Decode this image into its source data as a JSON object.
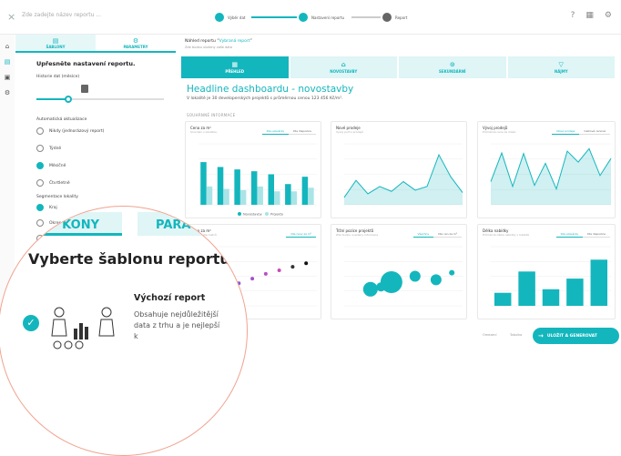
{
  "topbar": {
    "close_icon": "×",
    "title_placeholder": "Zde zadejte název reportu ...",
    "steps": [
      "Výběr dat",
      "Nastavení reportu",
      "Report"
    ],
    "icons": [
      "help-icon",
      "grid-icon",
      "settings-icon"
    ]
  },
  "rail": [
    "home-icon",
    "report-icon",
    "folder-icon",
    "settings-icon"
  ],
  "sidebar": {
    "tabs": [
      {
        "label": "ŠABLONY",
        "icon": "▤"
      },
      {
        "label": "PARAMETRY",
        "icon": "⚙"
      }
    ],
    "title": "Upřesněte nastavení reportu.",
    "history_label": "Historie dat (měsíce)",
    "history_value": 0.25,
    "auto_update_label": "Automatická aktualizace",
    "auto_update_options": [
      "Nikdy (jednorázový report)",
      "Týdně",
      "Měsíčně",
      "Čtvrtletně"
    ],
    "auto_update_selected": 2,
    "segmentation_label": "Segmentace lokality",
    "segmentation_options": [
      "Kraj",
      "Okres",
      ""
    ],
    "segmentation_selected": 0
  },
  "main": {
    "crumb_prefix": "Náhled reportu",
    "crumb_name": "Vybraná report",
    "crumb_sub": "Zde budou uloženy vaše data",
    "categories": [
      {
        "label": "PŘEHLED",
        "icon": "▦"
      },
      {
        "label": "NOVOSTAVBY",
        "icon": "⌂"
      },
      {
        "label": "SEKUNDÁRNÍ",
        "icon": "⊙"
      },
      {
        "label": "NÁJMY",
        "icon": "▽"
      }
    ],
    "active_category": 0,
    "headline": "Headline dashboardu - novostavby",
    "subline": "V lokalitě je 30 developerských projektů s průměrnou cenou 123 456 Kč/m².",
    "section": "SOUHRNNÉ INFORMACE"
  },
  "cards": [
    {
      "title": "Cena za m²",
      "sub": "Srovnání s lokalitou",
      "buttons": [
        "Dle uzávěrky",
        "Dle dispozice"
      ],
      "active": 0
    },
    {
      "title": "Nové prodeje",
      "sub": "Vývoj počtu prodejů",
      "buttons": [],
      "active": -1
    },
    {
      "title": "Vývoj prodejů",
      "sub": "Průměrná cena za měsíc",
      "buttons": [
        "Nové prodeje",
        "Celková cenová"
      ],
      "active": 0
    },
    {
      "title": "Cena za m²",
      "sub": "Srovnání dle metrů",
      "buttons": [
        "Dle ceny za m²"
      ],
      "active": 0
    },
    {
      "title": "Tržní pozice projektů",
      "sub": "Zde budou uvedeny informace",
      "buttons": [
        "Všechny",
        "Dle cen za m²"
      ],
      "active": 0
    },
    {
      "title": "Délka nabídky",
      "sub": "Průměrná délka nabídky v lokalitě",
      "buttons": [
        "Dle uzávěrky",
        "Dle dispozice"
      ],
      "active": 0
    }
  ],
  "chart_data": [
    {
      "type": "bar",
      "categories": [
        "1",
        "2",
        "3",
        "4",
        "5",
        "6",
        "7"
      ],
      "series": [
        {
          "name": "Novostavby",
          "values": [
            70,
            62,
            58,
            55,
            50,
            34,
            46
          ]
        },
        {
          "name": "Projekty",
          "values": [
            30,
            26,
            24,
            30,
            22,
            22,
            28
          ]
        }
      ],
      "ylim": [
        0,
        100
      ],
      "colors": [
        "#14b6bd",
        "#a9e4e7"
      ]
    },
    {
      "type": "area",
      "values": [
        12,
        40,
        18,
        30,
        22,
        38,
        24,
        30,
        82,
        46,
        20
      ],
      "ylim": [
        0,
        100
      ],
      "color": "#14b6bd"
    },
    {
      "type": "area",
      "values": [
        38,
        85,
        30,
        84,
        32,
        68,
        26,
        88,
        70,
        92,
        48,
        76
      ],
      "ylim": [
        0,
        100
      ],
      "color": "#14b6bd"
    },
    {
      "type": "scatter",
      "x": [
        1,
        2,
        3,
        4,
        5,
        6,
        7,
        8
      ],
      "y": [
        20,
        30,
        38,
        46,
        54,
        60,
        66,
        72
      ],
      "ylim": [
        0,
        100
      ],
      "colors": [
        "#6c3fd8",
        "#6c3fd8",
        "#8a55d6",
        "#a052cf",
        "#b84fc6",
        "#c94cb5",
        "#333",
        "#111"
      ]
    },
    {
      "type": "scatter",
      "x": [
        20,
        28,
        36,
        54,
        70,
        82
      ],
      "y": [
        28,
        32,
        40,
        50,
        44,
        56
      ],
      "sizes": [
        8,
        5,
        12,
        6,
        6,
        3
      ],
      "ylim": [
        0,
        100
      ],
      "color": "#14b6bd"
    },
    {
      "type": "bar",
      "categories": [
        "A",
        "B",
        "C",
        "D",
        "E"
      ],
      "values": [
        22,
        58,
        28,
        46,
        78
      ],
      "ylim": [
        0,
        100
      ],
      "color": "#14b6bd"
    }
  ],
  "overlay": {
    "tab1": "KONY",
    "tab2": "PARA",
    "title": "Vyberte šablonu reportu",
    "check": "✓",
    "name": "Výchozí report",
    "desc": "Obsahuje nejdůležitější data z trhu a je nejlepší k"
  },
  "fab": {
    "icon": "→",
    "label": "ULOŽIT A GENEROVAT"
  },
  "footer": [
    "Omezení",
    "Tabulka"
  ]
}
